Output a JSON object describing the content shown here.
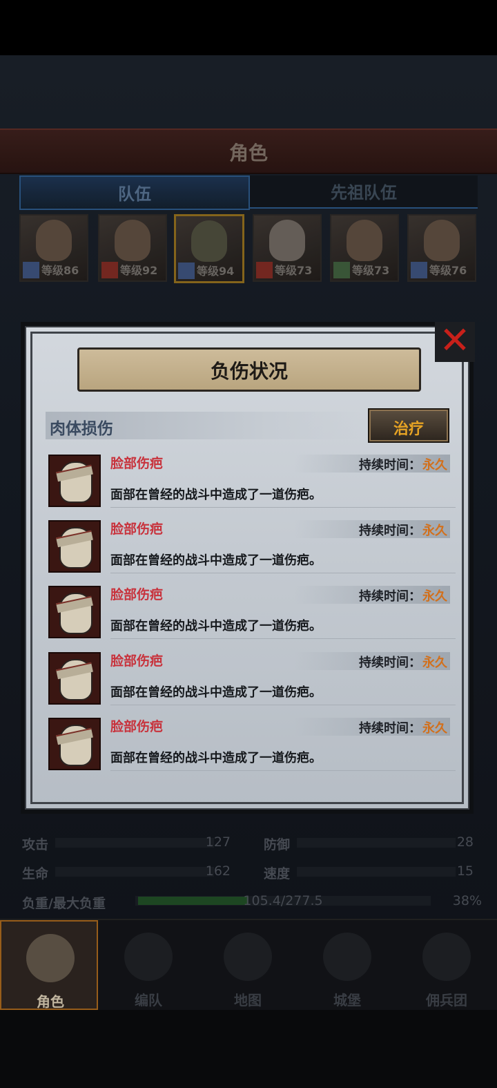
{
  "screen_title": "角色",
  "tabs": [
    "队伍",
    "先祖队伍"
  ],
  "heroes": [
    {
      "level": "等级86"
    },
    {
      "level": "等级92"
    },
    {
      "level": "等级94",
      "selected": true
    },
    {
      "level": "等级73"
    },
    {
      "level": "等级73"
    },
    {
      "level": "等级76"
    }
  ],
  "stats": {
    "attack_label": "攻击",
    "attack_value": "127",
    "defense_label": "防御",
    "defense_value": "28",
    "hp_label": "生命",
    "hp_value": "162",
    "speed_label": "速度",
    "speed_value": "15",
    "load_label": "负重/最大负重",
    "load_value": "105.4/277.5",
    "load_percent": "38%"
  },
  "nav": [
    "角色",
    "编队",
    "地图",
    "城堡",
    "佣兵团"
  ],
  "modal": {
    "title": "负伤状况",
    "close_icon": "close-x-icon",
    "section_title": "肉体损伤",
    "treat_label": "治疗",
    "injuries": [
      {
        "name": "脸部伤疤",
        "duration_label": "持续时间：",
        "duration_value": "永久",
        "desc": "面部在曾经的战斗中造成了一道伤疤。"
      },
      {
        "name": "脸部伤疤",
        "duration_label": "持续时间：",
        "duration_value": "永久",
        "desc": "面部在曾经的战斗中造成了一道伤疤。"
      },
      {
        "name": "脸部伤疤",
        "duration_label": "持续时间：",
        "duration_value": "永久",
        "desc": "面部在曾经的战斗中造成了一道伤疤。"
      },
      {
        "name": "脸部伤疤",
        "duration_label": "持续时间：",
        "duration_value": "永久",
        "desc": "面部在曾经的战斗中造成了一道伤疤。"
      },
      {
        "name": "脸部伤疤",
        "duration_label": "持续时间：",
        "duration_value": "永久",
        "desc": "面部在曾经的战斗中造成了一道伤疤。"
      }
    ]
  }
}
